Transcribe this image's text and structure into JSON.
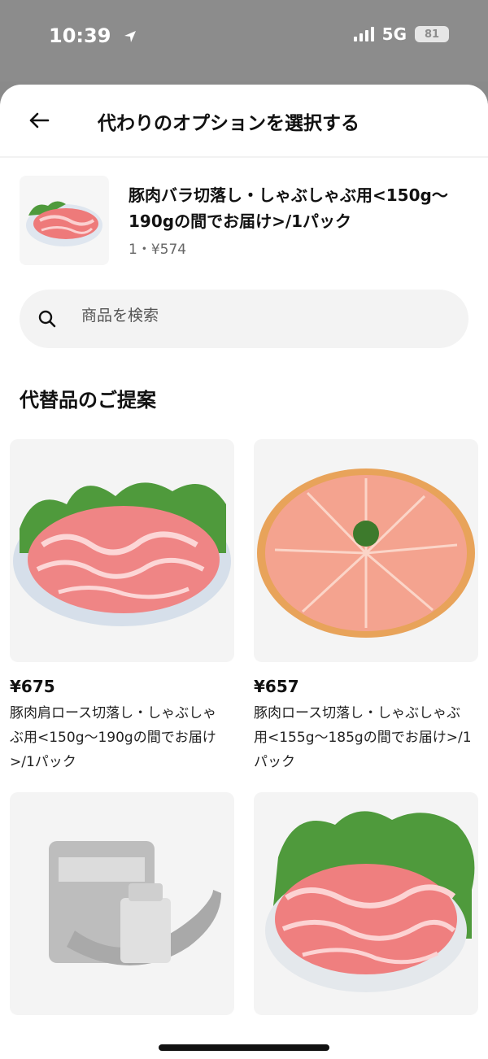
{
  "status": {
    "time": "10:39",
    "network": "5G",
    "battery": "81"
  },
  "header": {
    "title": "代わりのオプションを選択する"
  },
  "current_item": {
    "name": "豚肉バラ切落し・しゃぶしゃぶ用<150g〜190gの間でお届け>/1パック",
    "qty_price": "1・¥574"
  },
  "search": {
    "placeholder": "商品を検索"
  },
  "section": {
    "title": "代替品のご提案"
  },
  "suggestions": [
    {
      "price": "¥675",
      "name": "豚肉肩ロース切落し・しゃぶしゃぶ用<150g〜190gの間でお届け>/1パック"
    },
    {
      "price": "¥657",
      "name": "豚肉ロース切落し・しゃぶしゃぶ用<155g〜185gの間でお届け>/1パック"
    }
  ],
  "colors": {
    "status_bg": "#8c8c8c",
    "meat": "#ee7a7a",
    "lettuce": "#4f9a3c",
    "plate": "#dfe6ef"
  },
  "icons": [
    "location-arrow-icon",
    "signal-icon",
    "battery-icon",
    "back-arrow-icon",
    "search-icon"
  ]
}
